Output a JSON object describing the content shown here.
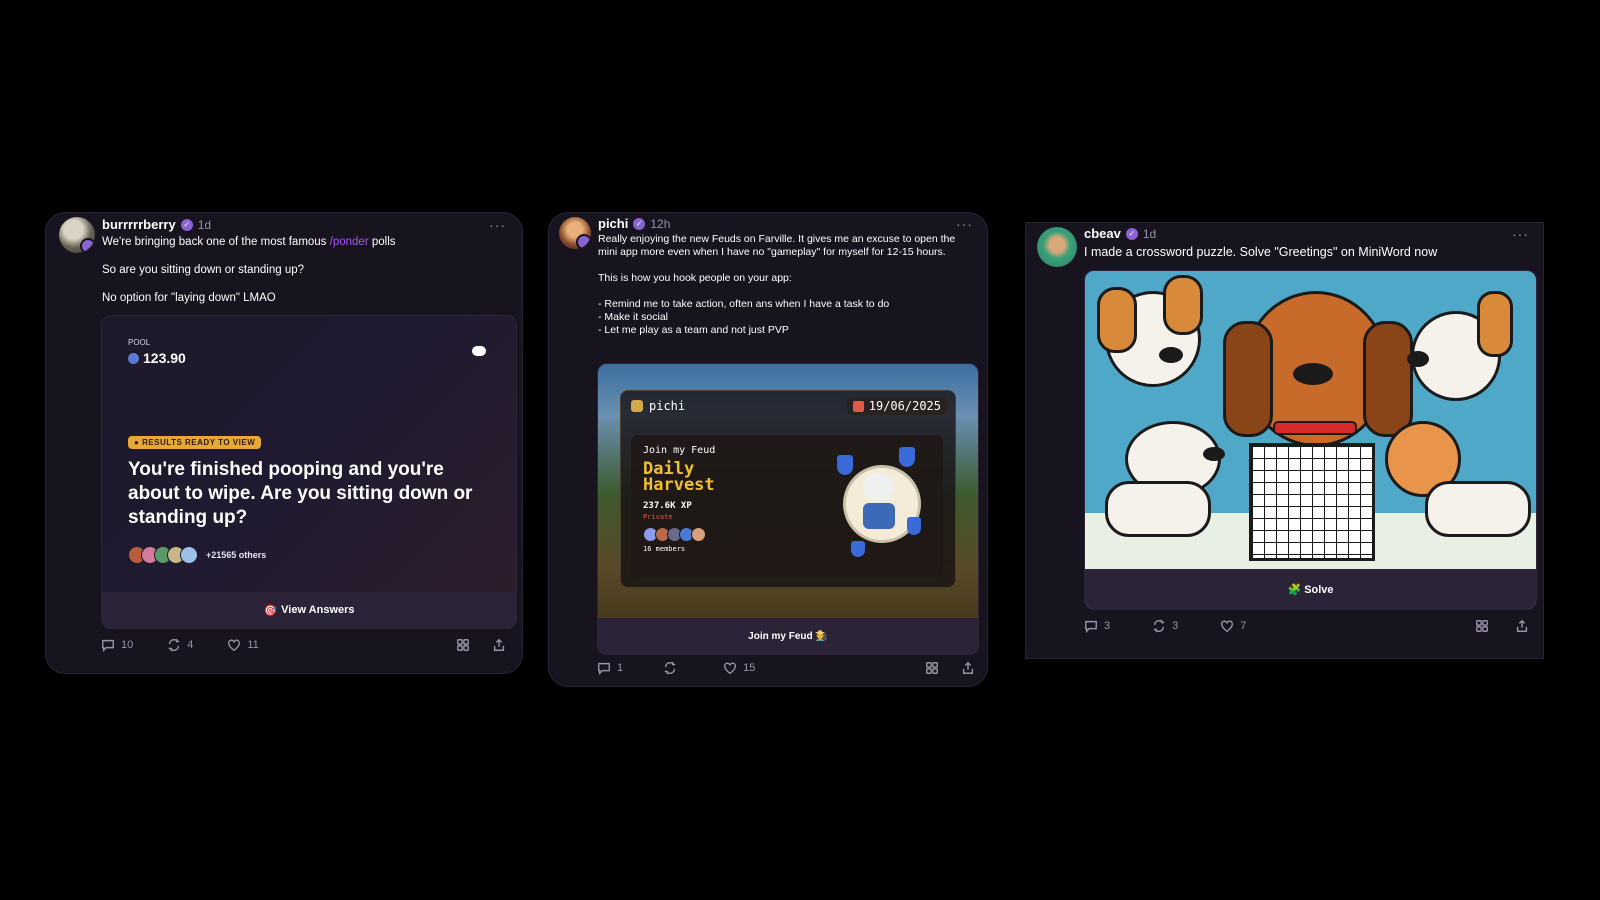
{
  "posts": [
    {
      "username": "burrrrrberry",
      "time": "1d",
      "more": "···",
      "text_before": "We're bringing back one of the most famous ",
      "mention": "/ponder",
      "text_after": " polls",
      "line2": "So are you sitting down or standing up?",
      "line3": "No option for \"laying down\" LMAO",
      "poll": {
        "pool_label": "POOL",
        "pool_value": "123.90",
        "badge": "RESULTS READY TO VIEW",
        "question": "You're finished pooping and you're about to wipe. Are you sitting down or standing up?",
        "others": "+21565 others",
        "button": "View Answers"
      },
      "stats": {
        "replies": "10",
        "recasts": "4",
        "likes": "11"
      }
    },
    {
      "username": "pichi",
      "time": "12h",
      "more": "···",
      "text": "Really enjoying the new Feuds on Farville. It gives me an excuse to open the mini app more even when I have no \"gameplay\" for myself for 12-15 hours.\n\nThis is how you hook people on your app:\n\n- Remind me to take action, often ans when I have a task to do\n- Make it social\n- Let me play as a team and not just PVP",
      "feud": {
        "user": "pichi",
        "date": "19/06/2025",
        "join_label": "Join my Feud",
        "title_line1": "Daily",
        "title_line2": "Harvest",
        "xp": "237.6K XP",
        "privacy": "Private",
        "members": "16 members",
        "button": "Join my Feud 🧑‍🌾"
      },
      "stats": {
        "replies": "1",
        "recasts": "",
        "likes": "15"
      }
    },
    {
      "username": "cbeav",
      "time": "1d",
      "more": "···",
      "text": "I made a crossword puzzle. Solve \"Greetings\" on MiniWord now",
      "button": "🧩 Solve",
      "stats": {
        "replies": "3",
        "recasts": "3",
        "likes": "7"
      }
    }
  ],
  "icons": {
    "reply": "comment-icon",
    "recast": "recast-icon",
    "like": "heart-icon",
    "grid": "grid-icon",
    "share": "share-icon"
  }
}
